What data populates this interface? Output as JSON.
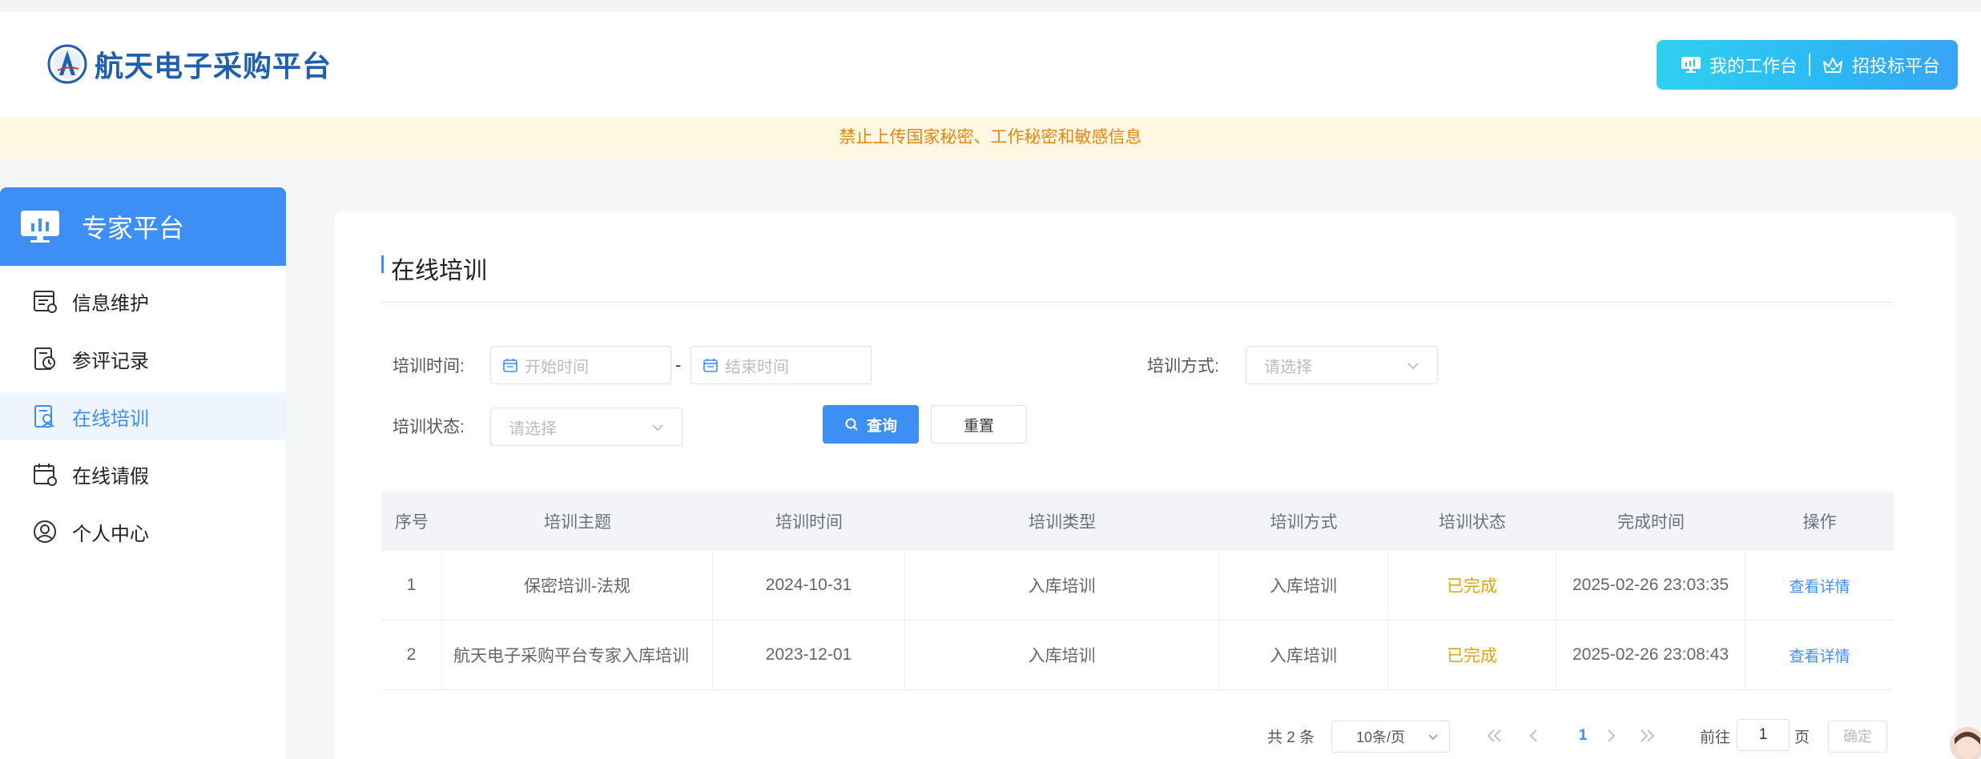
{
  "header": {
    "logo_text": "航天电子采购平台",
    "nav": [
      {
        "label": "我的工作台",
        "icon": "monitor-icon"
      },
      {
        "label": "招投标平台",
        "icon": "crown-icon"
      }
    ]
  },
  "notice": "禁止上传国家秘密、工作秘密和敏感信息",
  "sidebar": {
    "title": "专家平台",
    "items": [
      {
        "label": "信息维护",
        "icon": "info-form-icon",
        "active": false
      },
      {
        "label": "参评记录",
        "icon": "record-clock-icon",
        "active": false
      },
      {
        "label": "在线培训",
        "icon": "training-icon",
        "active": true
      },
      {
        "label": "在线请假",
        "icon": "calendar-icon",
        "active": false
      },
      {
        "label": "个人中心",
        "icon": "user-icon",
        "active": false
      }
    ]
  },
  "page": {
    "title": "在线培训",
    "filters": {
      "time_label": "培训时间:",
      "start_placeholder": "开始时间",
      "range_sep": "-",
      "end_placeholder": "结束时间",
      "mode_label": "培训方式:",
      "mode_placeholder": "请选择",
      "status_label": "培训状态:",
      "status_placeholder": "请选择",
      "query_label": "查询",
      "reset_label": "重置"
    },
    "table": {
      "columns": [
        "序号",
        "培训主题",
        "培训时间",
        "培训类型",
        "培训方式",
        "培训状态",
        "完成时间",
        "操作"
      ],
      "rows": [
        {
          "no": "1",
          "topic": "保密培训-法规",
          "time": "2024-10-31",
          "type": "入库培训",
          "mode": "入库培训",
          "status": "已完成",
          "finished": "2025-02-26 23:03:35",
          "action": "查看详情"
        },
        {
          "no": "2",
          "topic": "航天电子采购平台专家入库培训",
          "time": "2023-12-01",
          "type": "入库培训",
          "mode": "入库培训",
          "status": "已完成",
          "finished": "2025-02-26 23:08:43",
          "action": "查看详情"
        }
      ]
    },
    "pagination": {
      "total": "共 2 条",
      "page_size": "10条/页",
      "current_page": "1",
      "goto_label": "前往",
      "goto_value": "1",
      "page_unit": "页",
      "confirm_label": "确定"
    }
  },
  "colors": {
    "primary": "#3d8ef5",
    "notice_bg": "#fff7e2",
    "notice_text": "#e6860f",
    "status_done": "#e0a413"
  }
}
